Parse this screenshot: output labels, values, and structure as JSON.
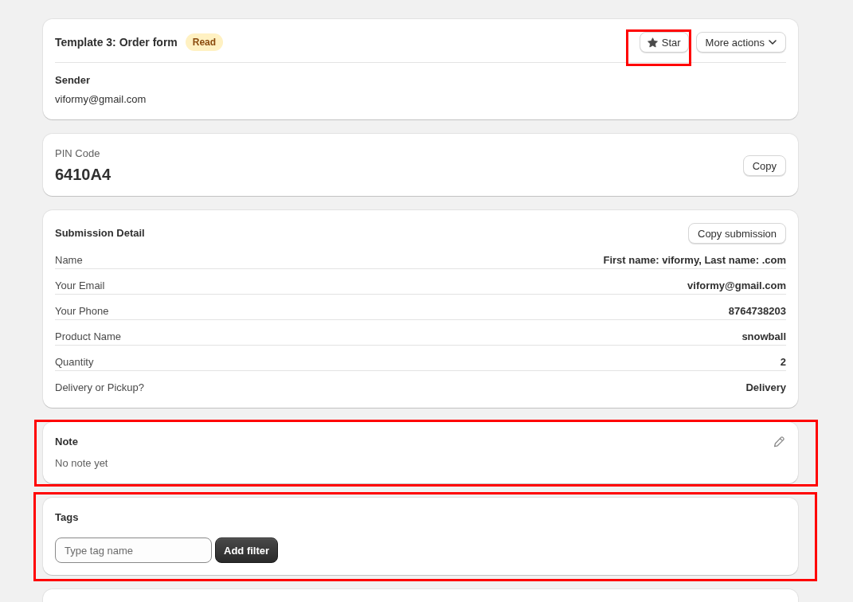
{
  "header_card": {
    "title": "Template 3: Order form",
    "status_badge": "Read",
    "star_button": {
      "label": "Star",
      "highlighted": true
    },
    "more_actions_button": "More actions",
    "sender_label": "Sender",
    "sender_email": "viformy@gmail.com"
  },
  "pin_card": {
    "label": "PIN Code",
    "code": "6410A4",
    "copy_button": "Copy"
  },
  "submission_card": {
    "title": "Submission Detail",
    "copy_button": "Copy submission",
    "fields": [
      {
        "label": "Name",
        "value": "First name: viformy, Last name: .com"
      },
      {
        "label": "Your Email",
        "value": "viformy@gmail.com"
      },
      {
        "label": "Your Phone",
        "value": "8764738203"
      },
      {
        "label": "Product Name",
        "value": "snowball"
      },
      {
        "label": "Quantity",
        "value": "2"
      },
      {
        "label": "Delivery or Pickup?",
        "value": "Delivery"
      }
    ]
  },
  "note_card": {
    "title": "Note",
    "text": "No note yet",
    "highlighted": true
  },
  "tags_card": {
    "title": "Tags",
    "input": {
      "placeholder": "Type tag name"
    },
    "add_button": "Add filter",
    "highlighted": true
  }
}
